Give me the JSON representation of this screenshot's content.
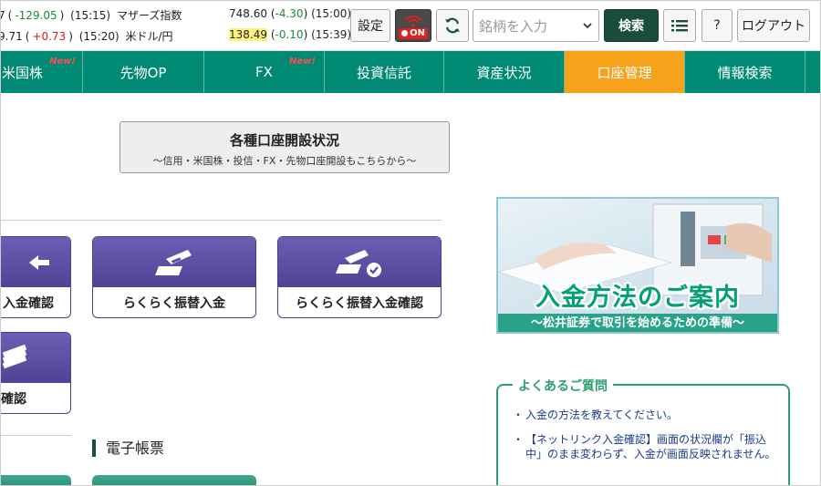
{
  "ticker": {
    "row1": {
      "left_value": "7",
      "left_change": "-129.05",
      "left_time": "(15:15)",
      "name": "マザーズ指数",
      "value": "748.60",
      "change": "-4.30",
      "time": "(15:00)"
    },
    "row2": {
      "left_value": "9.71",
      "left_change": "+0.73",
      "left_time": "(15:20)",
      "name": "米ドル/円",
      "value": "138.49",
      "change": "-0.10",
      "time": "(15:39)"
    }
  },
  "header": {
    "settings_label": "設定",
    "onoff_label": "ON",
    "search_placeholder": "銘柄を入力",
    "search_button": "検索",
    "help_label": "?",
    "logout_label": "ログアウト"
  },
  "nav": {
    "new_badge": "New!",
    "items": [
      {
        "label": "米国株"
      },
      {
        "label": "先物OP"
      },
      {
        "label": "FX"
      },
      {
        "label": "投資信託"
      },
      {
        "label": "資産状況"
      },
      {
        "label": "口座管理"
      },
      {
        "label": "情報検索"
      }
    ]
  },
  "account_status": {
    "title": "各種口座開設状況",
    "subtitle": "～信用・米国株・投信・FX・先物口座開設もこちらから～"
  },
  "tiles": {
    "t1": "入金確認",
    "t2": "らくらく振替入金",
    "t3": "らくらく振替入金確認",
    "t4": "確認"
  },
  "sections": {
    "denshi": "電子帳票"
  },
  "banner": {
    "title": "入金方法のご案内",
    "subtitle": "～松井証券で取引を始めるための準備～"
  },
  "faq": {
    "heading": "よくあるご質問",
    "items": [
      "入金の方法を教えてください。",
      "【ネットリンク入金確認】画面の状況欄が「振込中」のまま変わらず、入金が画面反映されません。"
    ]
  },
  "colors": {
    "nav_green": "#008a73",
    "active_orange": "#f6a21a",
    "search_button": "#1b4d3e",
    "tile_purple": "#5a4ea6",
    "change_negative": "#1a8a3a",
    "change_positive": "#d21b1b"
  }
}
